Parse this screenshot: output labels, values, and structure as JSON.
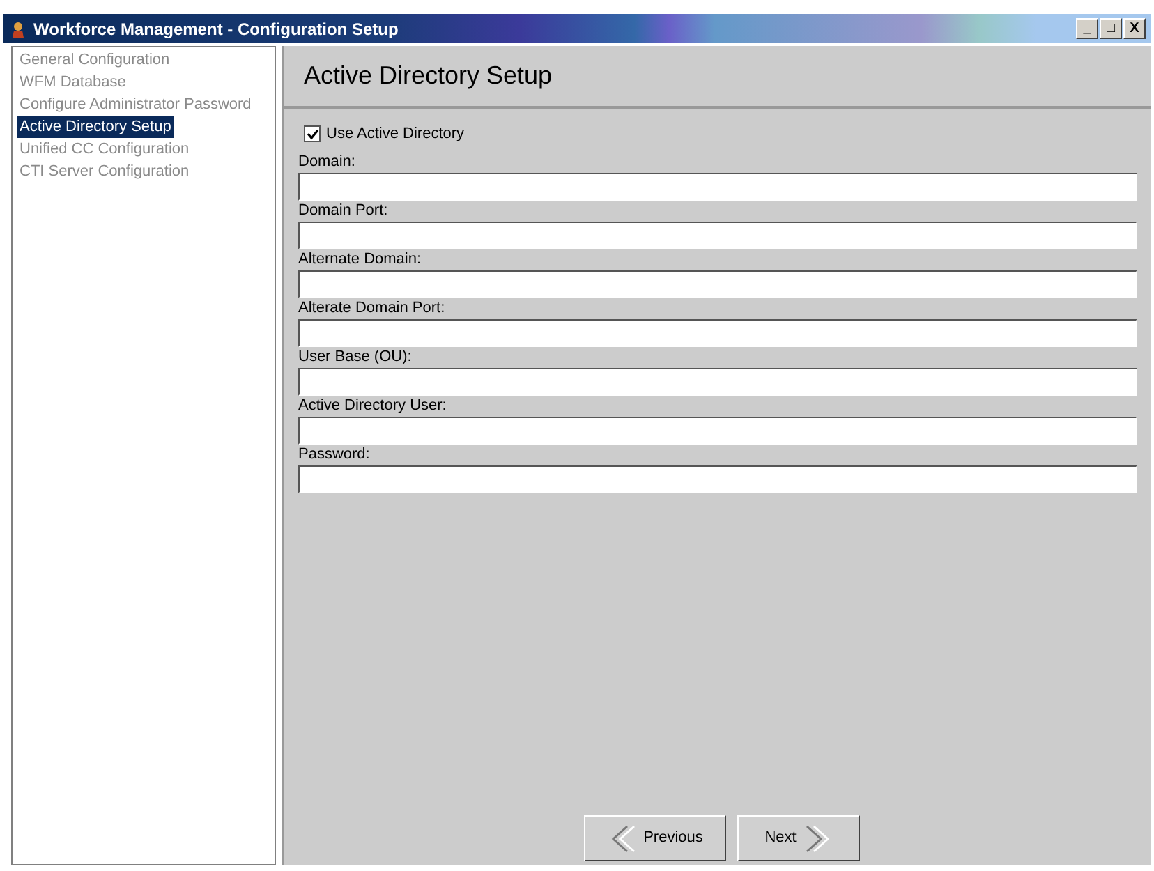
{
  "window": {
    "title": "Workforce Management - Configuration Setup",
    "controls": [
      "_",
      "□",
      "X"
    ]
  },
  "sidebar": {
    "items": [
      {
        "label": "General Configuration",
        "selected": false
      },
      {
        "label": "WFM Database",
        "selected": false
      },
      {
        "label": "Configure Administrator Password",
        "selected": false
      },
      {
        "label": "Active Directory Setup",
        "selected": true
      },
      {
        "label": "Unified CC Configuration",
        "selected": false
      },
      {
        "label": "CTI Server Configuration",
        "selected": false
      }
    ]
  },
  "page": {
    "title": "Active Directory Setup",
    "use_active_directory": {
      "label": "Use Active Directory",
      "checked": true
    },
    "fields": [
      {
        "label": "Domain:"
      },
      {
        "label": "Domain Port:"
      },
      {
        "label": "Alternate Domain:"
      },
      {
        "label": "Alterate Domain Port:"
      },
      {
        "label": "User Base (OU):"
      },
      {
        "label": "Active Directory User:"
      },
      {
        "label": "Password:"
      }
    ]
  },
  "buttons": [
    {
      "kind": "previous",
      "label": "Previous"
    },
    {
      "kind": "next",
      "label": "Next"
    }
  ]
}
